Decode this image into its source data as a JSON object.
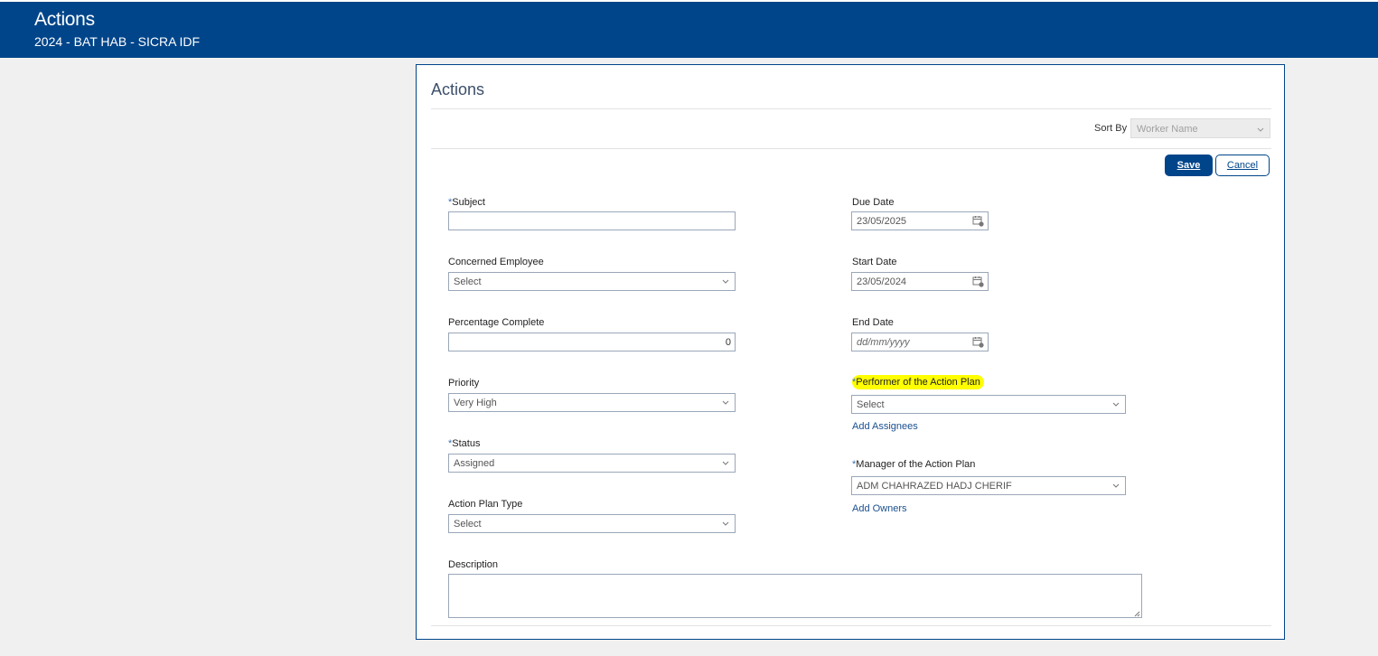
{
  "header": {
    "title": "Actions",
    "subtitle": "2024 - BAT HAB - SICRA IDF"
  },
  "panel": {
    "title": "Actions",
    "sort_by_label": "Sort By",
    "sort_by_value": "Worker Name"
  },
  "buttons": {
    "save": "Save",
    "cancel": "Cancel"
  },
  "form": {
    "required_marker": "*",
    "subject": {
      "label": "Subject",
      "value": ""
    },
    "concerned_employee": {
      "label": "Concerned Employee",
      "value": "Select"
    },
    "percentage_complete": {
      "label": "Percentage Complete",
      "value": "0"
    },
    "priority": {
      "label": "Priority",
      "value": "Very High"
    },
    "status": {
      "label": "Status",
      "value": "Assigned"
    },
    "action_plan_type": {
      "label": "Action Plan Type",
      "value": "Select"
    },
    "description": {
      "label": "Description",
      "value": ""
    },
    "due_date": {
      "label": "Due Date",
      "value": "23/05/2025"
    },
    "start_date": {
      "label": "Start Date",
      "value": "23/05/2024"
    },
    "end_date": {
      "label": "End Date",
      "placeholder": "dd/mm/yyyy"
    },
    "performer": {
      "label": "Performer of the Action Plan",
      "value": "Select",
      "link": "Add Assignees"
    },
    "manager": {
      "label": "Manager of the Action Plan",
      "value": "ADM CHAHRAZED HADJ CHERIF",
      "link": "Add Owners"
    }
  },
  "colors": {
    "brand": "#00458a",
    "highlight": "#ffff00"
  },
  "icons": {
    "select_arrow": "chevron-down-icon",
    "date_picker": "calendar-icon",
    "textarea_resize": "resize-handle-icon"
  }
}
